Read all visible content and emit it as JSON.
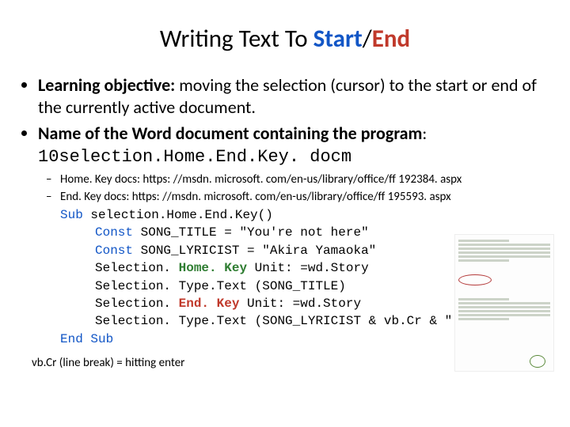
{
  "title": {
    "t1": "Writing Text To ",
    "t2": "Start",
    "t3": "/",
    "t4": "End"
  },
  "b1": {
    "label": "Learning objective:",
    "text": " moving the selection (cursor) to the start or end of the currently active document."
  },
  "b2": {
    "label": "Name of the Word document containing the program",
    "colon": ": ",
    "code": "10selection.Home.End.Key. docm"
  },
  "docs": {
    "home": "Home. Key docs: https: //msdn. microsoft. com/en-us/library/office/ff 192384. aspx",
    "end": "End. Key docs: https: //msdn. microsoft. com/en-us/library/office/ff 195593. aspx"
  },
  "code": {
    "subOpen1": "Sub",
    "subOpen2": " selection.Home.End.Key()",
    "c1a": "Const",
    "c1b": " SONG_TITLE = \"You're not here\"",
    "c2a": "Const",
    "c2b": " SONG_LYRICIST = \"Akira Yamaoka\"",
    "l3a": "Selection. ",
    "l3hk": "Home. Key",
    "l3b": " Unit: =wd.Story",
    "l4": "Selection. Type.Text (SONG_TITLE)",
    "l5a": "Selection. ",
    "l5ek": "End. Key",
    "l5b": " Unit: =wd.Story",
    "l6": "Selection. Type.Text (SONG_LYRICIST & vb.Cr & \"!\")",
    "endSub": "End Sub"
  },
  "footnote": "vb.Cr (line break) = hitting enter"
}
